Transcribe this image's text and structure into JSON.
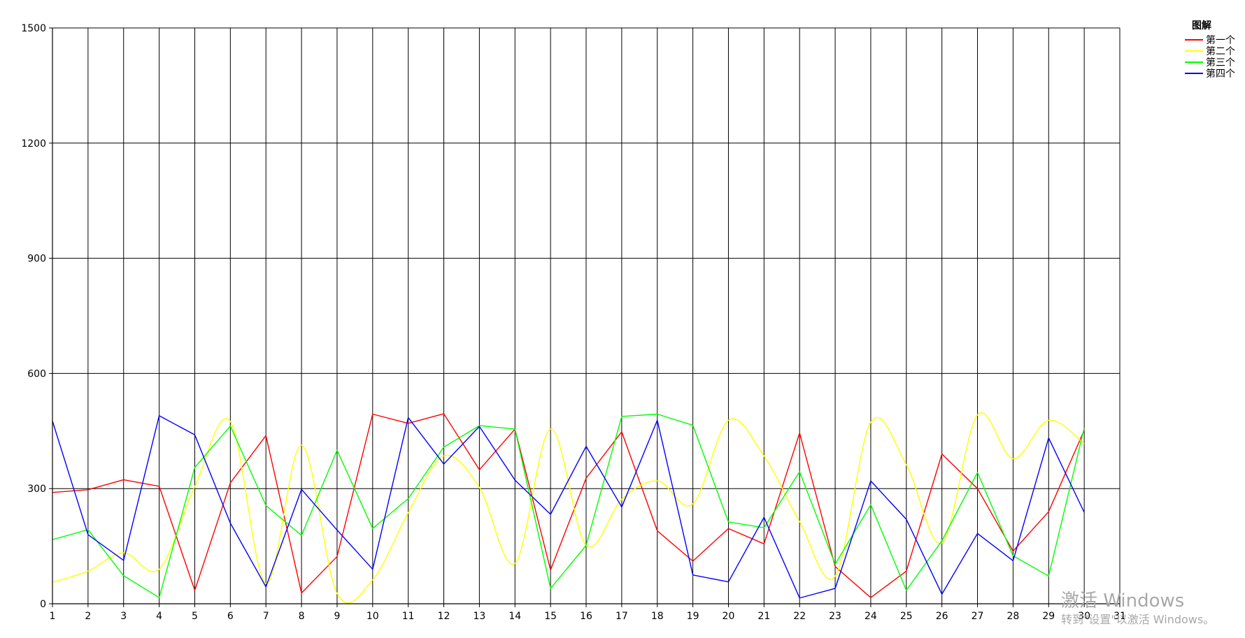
{
  "chart_data": {
    "type": "line",
    "title": "",
    "xlabel": "",
    "ylabel": "",
    "x_ticks": [
      "1",
      "2",
      "3",
      "4",
      "5",
      "6",
      "7",
      "8",
      "9",
      "10",
      "11",
      "12",
      "13",
      "14",
      "15",
      "16",
      "17",
      "18",
      "19",
      "20",
      "21",
      "22",
      "23",
      "24",
      "25",
      "26",
      "27",
      "28",
      "29",
      "30",
      "31"
    ],
    "xlim": [
      1,
      31
    ],
    "y_ticks": [
      "0",
      "300",
      "600",
      "900",
      "1200",
      "1500"
    ],
    "ylim": [
      0,
      1500
    ],
    "grid": true,
    "legend": {
      "title": "图解",
      "placement": "top-right"
    },
    "series": [
      {
        "name": "第一个",
        "color": "#ff0000",
        "smooth": false,
        "values": [
          290,
          297,
          323,
          306,
          35,
          315,
          438,
          28,
          123,
          494,
          470,
          495,
          349,
          455,
          88,
          327,
          448,
          190,
          111,
          196,
          156,
          445,
          97,
          16,
          85,
          390,
          300,
          137,
          240,
          452
        ]
      },
      {
        "name": "第二个",
        "color": "#ffff00",
        "smooth": true,
        "values": [
          56,
          85,
          133,
          90,
          305,
          475,
          53,
          413,
          27,
          62,
          237,
          385,
          303,
          105,
          455,
          152,
          272,
          320,
          260,
          478,
          385,
          214,
          72,
          473,
          362,
          159,
          492,
          378,
          478,
          417
        ]
      },
      {
        "name": "第三个",
        "color": "#00ff00",
        "smooth": false,
        "values": [
          167,
          193,
          73,
          16,
          355,
          463,
          256,
          178,
          400,
          196,
          274,
          408,
          464,
          455,
          40,
          152,
          488,
          494,
          465,
          213,
          198,
          344,
          103,
          258,
          35,
          164,
          342,
          125,
          72,
          458
        ]
      },
      {
        "name": "第四个",
        "color": "#0000ff",
        "smooth": false,
        "values": [
          476,
          180,
          113,
          490,
          440,
          210,
          44,
          298,
          192,
          90,
          485,
          364,
          462,
          322,
          233,
          410,
          252,
          478,
          75,
          57,
          225,
          15,
          40,
          320,
          220,
          25,
          183,
          112,
          432,
          238
        ]
      }
    ]
  },
  "watermark": {
    "line1": "激活 Windows",
    "line2": "转到\"设置\"以激活 Windows。"
  }
}
